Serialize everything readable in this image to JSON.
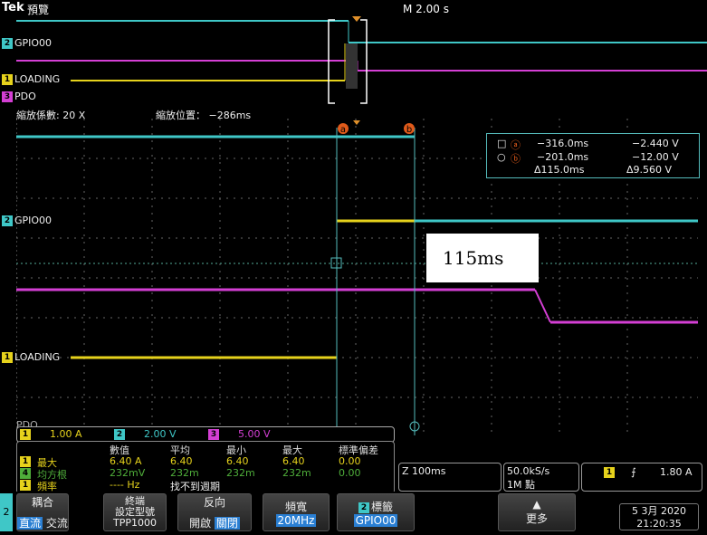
{
  "header": {
    "brand": "Tek",
    "mode": "預覽",
    "timebase": "M 2.00 s"
  },
  "overview": {
    "ch2_badge": "2",
    "ch2_label": "GPIO00",
    "ch1_badge": "1",
    "ch1_label": "LOADING",
    "ch3_badge": "3",
    "ch3_label": "PDO"
  },
  "zoom": {
    "factor": "縮放係數: 20 X",
    "position": "縮放位置： −286ms"
  },
  "main": {
    "ch2_badge": "2",
    "ch2_label": "GPIO00",
    "ch1_badge": "1",
    "ch1_label": "LOADING",
    "ch3_label": "PDO",
    "cursor_a": "a",
    "cursor_b": "b"
  },
  "cursors": {
    "a_time": "−316.0ms",
    "a_volt": "−2.440 V",
    "b_time": "−201.0ms",
    "b_volt": "−12.00 V",
    "d_time": "Δ115.0ms",
    "d_volt": "Δ9.560 V"
  },
  "annotation": "115ms",
  "scale": {
    "ch1": "1.00 A",
    "ch2": "2.00 V",
    "ch3": "5.00 V",
    "ch1_badge": "1",
    "ch2_badge": "2",
    "ch3_badge": "3"
  },
  "measurements": {
    "headers": [
      "數值",
      "平均",
      "最小",
      "最大",
      "標準偏差"
    ],
    "rows": [
      {
        "badge": "1",
        "name": "最大",
        "values": [
          "6.40 A",
          "6.40",
          "6.40",
          "6.40",
          "0.00"
        ]
      },
      {
        "badge": "4",
        "name": "均方根",
        "values": [
          "232mV",
          "232m",
          "232m",
          "232m",
          "0.00"
        ]
      },
      {
        "badge": "1",
        "name": "頻率",
        "values": [
          "---- Hz",
          "找不到週期",
          "",
          "",
          ""
        ]
      }
    ]
  },
  "horizontal": {
    "zoom_time": "Z 100ms",
    "rate": "50.0kS/s",
    "points": "1M 點"
  },
  "trigger": {
    "badge": "1",
    "slope": "⨍",
    "level": "1.80 A"
  },
  "bottom": {
    "channel": "2",
    "coupling_title": "耦合",
    "coupling_dc": "直流",
    "coupling_ac": "交流",
    "term_title": "終端",
    "term_line2": "設定型號",
    "term_line3": "TPP1000",
    "invert_title": "反向",
    "invert_on": "開啟",
    "invert_off": "關閉",
    "bw_title": "頻寬",
    "bw_value": "20MHz",
    "label_badge": "2",
    "label_title": "標籤",
    "label_value": "GPIO00",
    "more": "更多",
    "date": "5 3月 2020",
    "time": "21:20:35"
  },
  "colors": {
    "ch1": "#e6d21c",
    "ch2": "#3fc7c7",
    "ch3": "#d43fd4",
    "ch4": "#4fae3a",
    "cursor": "#e05a1a"
  }
}
